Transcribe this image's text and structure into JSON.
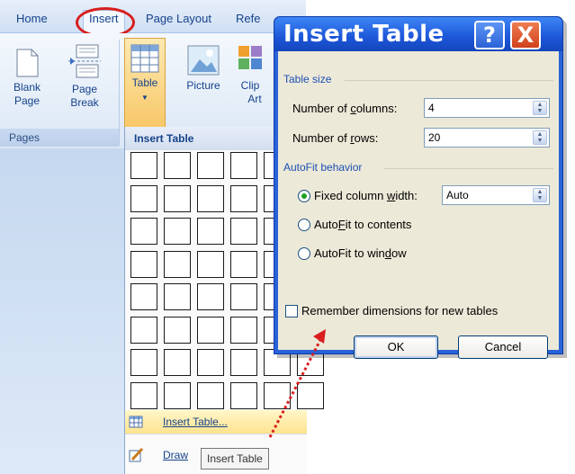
{
  "ribbon": {
    "tabs": [
      "Home",
      "Insert",
      "Page Layout",
      "Refe"
    ],
    "active_tab": "Insert",
    "buttons": {
      "blank_page": [
        "Blank",
        "Page"
      ],
      "page_break": [
        "Page",
        "Break"
      ],
      "table": "Table",
      "picture": "Picture",
      "clip_art": [
        "Clip",
        "Art"
      ]
    },
    "group_label": "Pages"
  },
  "table_menu": {
    "title": "Insert Table",
    "items": {
      "insert_table": "Insert Table...",
      "draw_table": "Draw"
    },
    "tooltip": "Insert Table"
  },
  "dialog": {
    "title": "Insert Table",
    "help_label": "?",
    "close_label": "X",
    "table_size": {
      "heading": "Table size",
      "columns_label_pre": "Number of ",
      "columns_label_u": "c",
      "columns_label_post": "olumns:",
      "columns_value": "4",
      "rows_label_pre": "Number of ",
      "rows_label_u": "r",
      "rows_label_post": "ows:",
      "rows_value": "20"
    },
    "autofit": {
      "heading": "AutoFit behavior",
      "fixed_pre": "Fixed column ",
      "fixed_u": "w",
      "fixed_post": "idth:",
      "fixed_value": "Auto",
      "contents_pre": "Auto",
      "contents_u": "F",
      "contents_post": "it to contents",
      "window_pre": "AutoFit to win",
      "window_u": "d",
      "window_post": "ow",
      "selected": "fixed"
    },
    "remember_label": "Remember dimensions for new tables",
    "ok_label": "OK",
    "cancel_label": "Cancel"
  },
  "colors": {
    "highlight_circle": "#d81e1e",
    "arrow": "#d81e1e",
    "dialog_title_bar": "#1d56d8",
    "menu_highlight": "#ffe38f"
  }
}
